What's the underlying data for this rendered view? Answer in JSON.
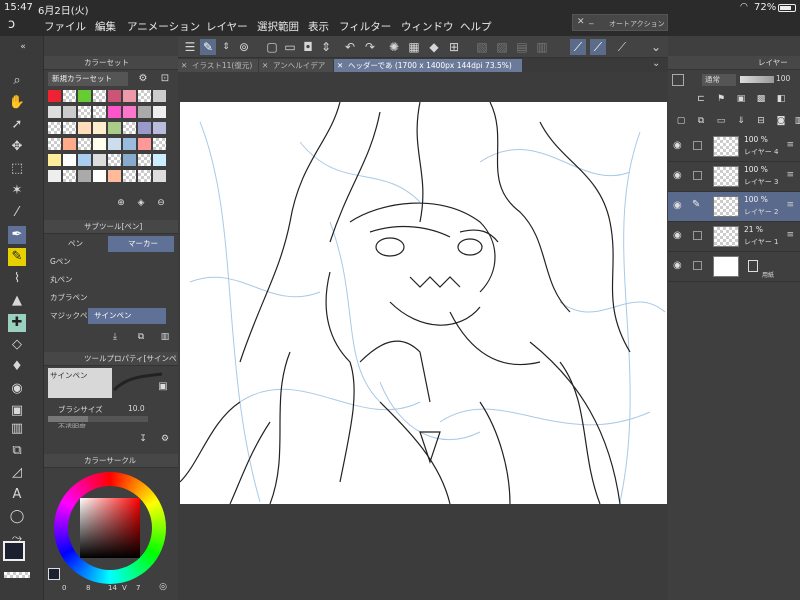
{
  "status": {
    "time": "15:47",
    "date": "6月2日(火)",
    "battery": "72%"
  },
  "menu": {
    "app_icon": "ↄ",
    "items": [
      "ファイル",
      "編集",
      "アニメーション",
      "レイヤー",
      "選択範囲",
      "表示",
      "フィルター",
      "ウィンドウ",
      "ヘルプ"
    ]
  },
  "autoaction": {
    "title": "オートアクション"
  },
  "tabs": [
    {
      "label": "イラスト11(復元)"
    },
    {
      "label": "アンヘルイデア"
    },
    {
      "label": "ヘッダーであ (1700 x 1400px 144dpi 73.5%)"
    }
  ],
  "colorset": {
    "title": "カラーセット",
    "preset": "新規カラーセット"
  },
  "subtool": {
    "title": "サブツール[ペン]",
    "tab_pen": "ペン",
    "tab_marker": "マーカー",
    "items": [
      "Gペン",
      "丸ペン",
      "カブラペン",
      "マジックペン",
      "サインペン"
    ]
  },
  "toolprop": {
    "title": "ツールプロパティ[サインペン]",
    "brush_name": "サインペン",
    "brush_size_label": "ブラシサイズ",
    "brush_size_value": "10.0",
    "opacity_label": "不透明度"
  },
  "colorwheel": {
    "title": "カラーサークル",
    "values": {
      "h": "0",
      "s": "8",
      "v": "14",
      "v2": "V",
      "n": "7"
    }
  },
  "layers": {
    "title": "レイヤー",
    "blend": "通常",
    "opacity": "100",
    "items": [
      {
        "pct": "100 %",
        "name": "レイヤー 4"
      },
      {
        "pct": "100 %",
        "name": "レイヤー 3"
      },
      {
        "pct": "100 %",
        "name": "レイヤー 2"
      },
      {
        "pct": "21 %",
        "name": "レイヤー 1"
      },
      {
        "pct": "",
        "name": "用紙"
      }
    ]
  },
  "colors": {
    "accent": "#5f7196",
    "panel": "#3f3f3f",
    "canvas": "#ffffff"
  }
}
